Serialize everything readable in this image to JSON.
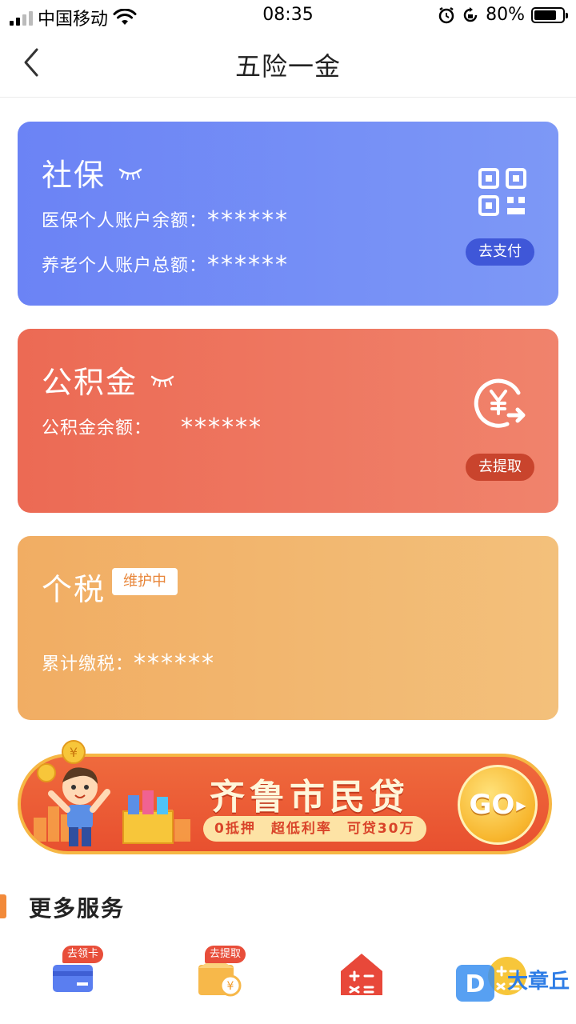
{
  "status_bar": {
    "carrier": "中国移动",
    "time": "08:35",
    "battery": "80%",
    "battery_level": 0.8
  },
  "nav": {
    "title": "五险一金"
  },
  "social": {
    "title": "社保",
    "medical_label": "医保个人账户余额：",
    "medical_value": "******",
    "pension_label": "养老个人账户总额：",
    "pension_value": "******",
    "action": "去支付",
    "icon": "qr-code-icon",
    "color": "#6b83f5"
  },
  "fund": {
    "title": "公积金",
    "balance_label": "公积金余额：",
    "balance_value": "******",
    "action": "去提取",
    "icon": "yen-exchange-icon",
    "color": "#ec6a54"
  },
  "tax": {
    "title": "个税",
    "badge": "维护中",
    "total_label": "累计缴税：",
    "total_value": "******",
    "color": "#f1ad63"
  },
  "banner": {
    "title": "齐鲁市民贷",
    "subtitle": "0抵押　超低利率　可贷30万",
    "go": "GO"
  },
  "more": {
    "title": "更多服务",
    "services": [
      {
        "tag": "去领卡",
        "icon": "card-icon"
      },
      {
        "tag": "去提取",
        "icon": "wallet-yen-icon"
      },
      {
        "tag": "",
        "icon": "calculator-house-icon"
      },
      {
        "tag": "",
        "icon": "calculator-icon"
      }
    ]
  },
  "watermark": {
    "text": "大章丘"
  }
}
